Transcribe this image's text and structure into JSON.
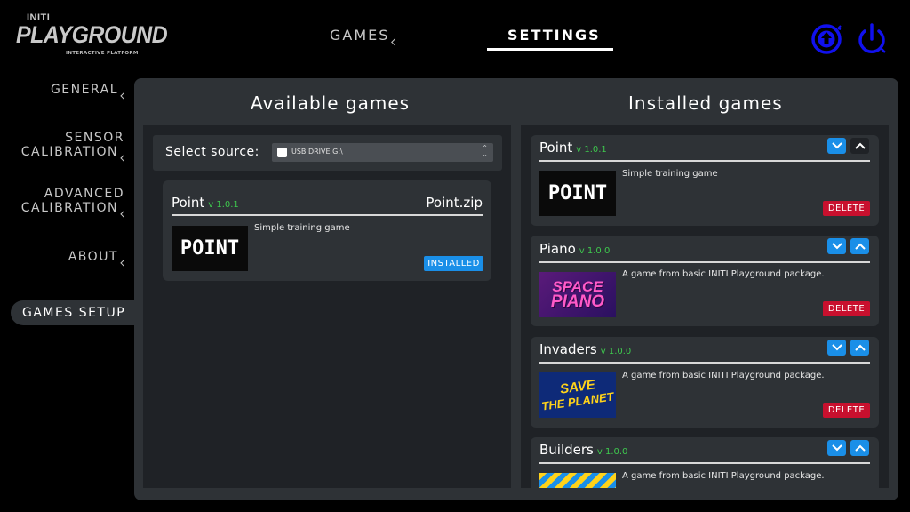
{
  "logo": {
    "brand_top": "INITI",
    "brand_main": "PLAYGROUND",
    "brand_sub": "INTERACTIVE PLATFORM"
  },
  "topnav": {
    "games": "GAMES",
    "settings": "SETTINGS"
  },
  "icons": {
    "update": "cloud-upload-icon",
    "power": "power-icon"
  },
  "sidebar": {
    "items": [
      {
        "line1": "GENERAL",
        "line2": ""
      },
      {
        "line1": "SENSOR",
        "line2": "CALIBRATION"
      },
      {
        "line1": "ADVANCED",
        "line2": "CALIBRATION"
      },
      {
        "line1": "ABOUT",
        "line2": ""
      }
    ],
    "active": "GAMES SETUP"
  },
  "available": {
    "title": "Available games",
    "source_label": "Select source:",
    "source_value": "USB DRIVE G:\\",
    "games": [
      {
        "name": "Point",
        "version": "v 1.0.1",
        "file": "Point.zip",
        "description": "Simple training game",
        "thumb_text": "POINT",
        "status": "INSTALLED"
      }
    ]
  },
  "installed": {
    "title": "Installed games",
    "delete_label": "DELETE",
    "games": [
      {
        "name": "Point",
        "version": "v 1.0.1",
        "description": "Simple training game",
        "thumb_text": "POINT"
      },
      {
        "name": "Piano",
        "version": "v 1.0.0",
        "description": "A game from basic INITI Playground package.",
        "thumb_line1": "SPACE",
        "thumb_line2": "PIANO"
      },
      {
        "name": "Invaders",
        "version": "v 1.0.0",
        "description": "A game from basic INITI Playground package.",
        "thumb_line1": "SAVE",
        "thumb_line2": "THE PLANET"
      },
      {
        "name": "Builders",
        "version": "v 1.0.0",
        "description": "A game from basic INITI Playground package."
      }
    ]
  },
  "colors": {
    "accent": "#1a8fe8",
    "delete": "#c8102e",
    "version": "#3ec94e",
    "panel": "#2e3236",
    "inner": "#1f2226"
  }
}
